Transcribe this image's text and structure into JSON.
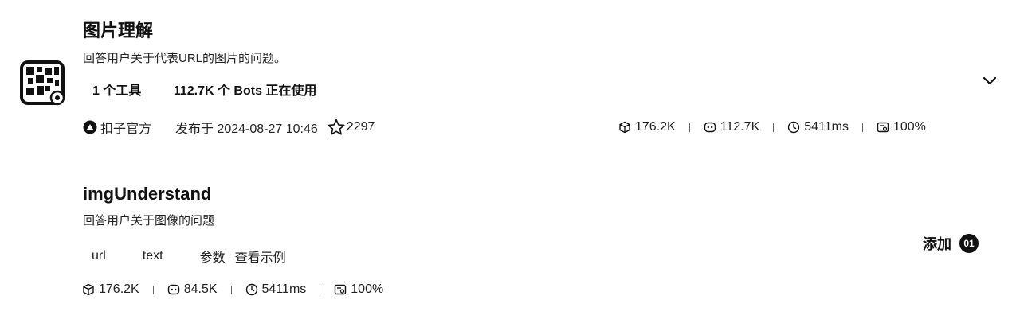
{
  "plugin": {
    "title": "图片理解",
    "description": "回答用户关于代表URL的图片的问题。",
    "tool_count": "1 个工具",
    "bot_usage": "112.7K 个 Bots 正在使用",
    "publisher": "扣子官方",
    "published": "发布于 2024-08-27 10:46",
    "favorites": "2297",
    "stats": {
      "calls": "176.2K",
      "bots": "112.7K",
      "latency": "5411ms",
      "success_rate": "100%"
    },
    "expand_icon": "chevron-down-icon"
  },
  "tool": {
    "name": "imgUnderstand",
    "description": "回答用户关于图像的问题",
    "params": [
      "url",
      "text"
    ],
    "params_label": "参数",
    "example_link": "查看示例",
    "stats": {
      "calls": "176.2K",
      "bots": "84.5K",
      "latency": "5411ms",
      "success_rate": "100%"
    },
    "add_label": "添加",
    "add_count": "01"
  }
}
